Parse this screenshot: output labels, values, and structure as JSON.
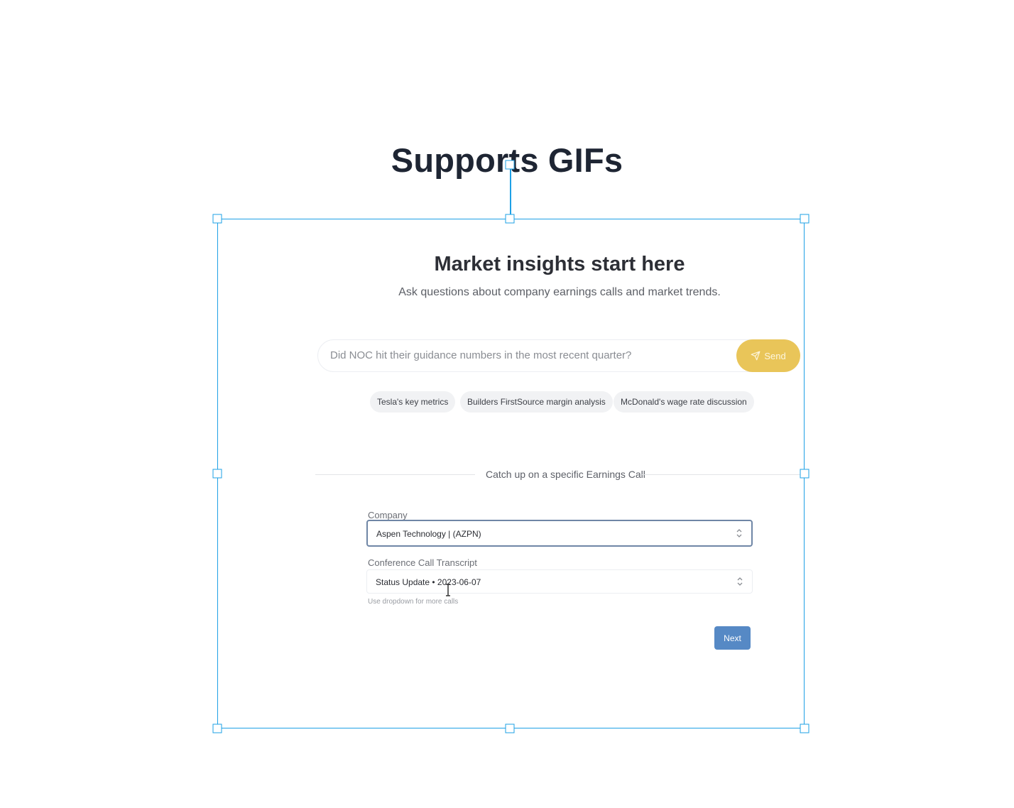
{
  "canvas": {
    "title": "Supports GIFs"
  },
  "gif": {
    "hero": {
      "title": "Market insights start here",
      "subtitle": "Ask questions about company earnings calls and market trends."
    },
    "search": {
      "placeholder": "Did NOC hit their guidance numbers in the most recent quarter?",
      "send_label": "Send",
      "send_icon": "send-icon"
    },
    "suggestions": [
      "Tesla's key metrics",
      "Builders FirstSource margin analysis",
      "McDonald's wage rate discussion"
    ],
    "divider_text": "Catch up on a specific Earnings Call",
    "company": {
      "label": "Company",
      "value": "Aspen Technology | (AZPN)"
    },
    "transcript": {
      "label": "Conference Call Transcript",
      "value": "Status Update • 2023-06-07",
      "help": "Use dropdown for more calls"
    },
    "next_label": "Next"
  },
  "colors": {
    "selection": "#1ea0e6",
    "send_button": "#e9c559",
    "next_button": "#5689c5",
    "title": "#1e2533"
  }
}
